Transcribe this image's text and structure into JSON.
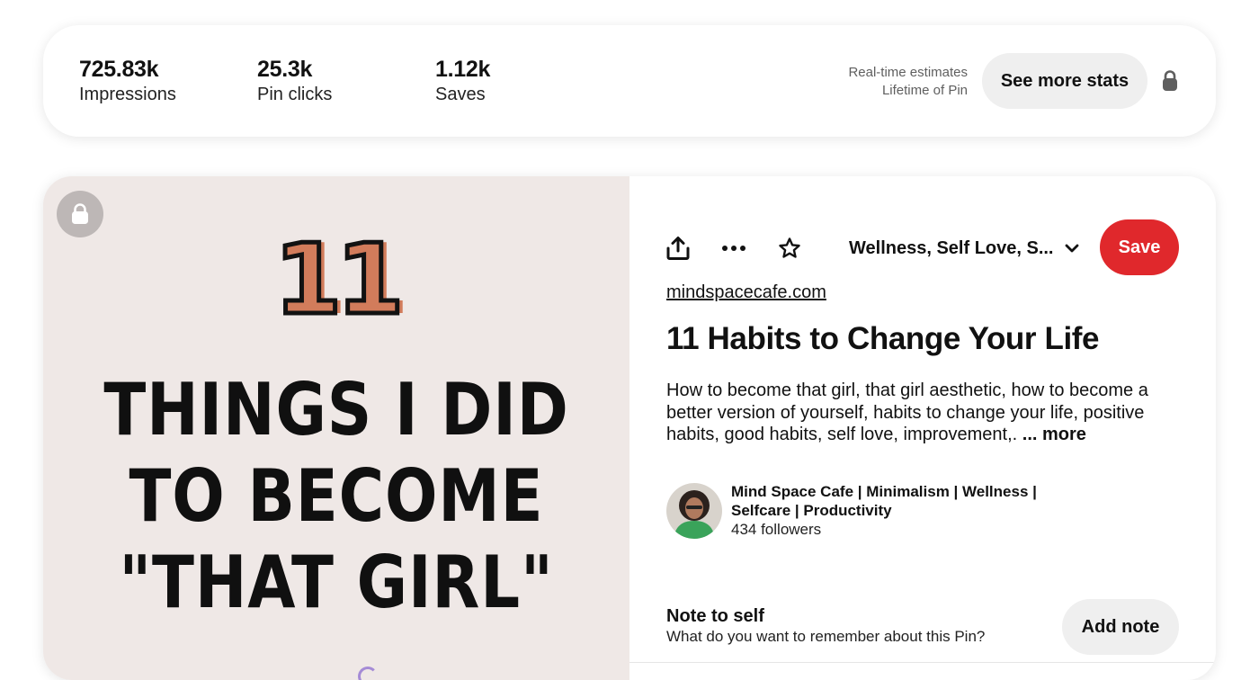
{
  "stats": {
    "impressions": {
      "value": "725.83k",
      "label": "Impressions"
    },
    "pin_clicks": {
      "value": "25.3k",
      "label": "Pin clicks"
    },
    "saves": {
      "value": "1.12k",
      "label": "Saves"
    },
    "estimate_line1": "Real-time estimates",
    "estimate_line2": "Lifetime of Pin",
    "see_more_label": "See more stats",
    "lock_icon": "lock-icon"
  },
  "pin_image": {
    "number": "11",
    "headline_lines": [
      "THINGS I DID",
      "TO BECOME",
      "\"THAT GIRL\""
    ],
    "background": "#efe8e6",
    "accent": "#d27c5b",
    "lock_icon": "lock-icon"
  },
  "toolbar": {
    "share_icon": "share-icon",
    "more_icon": "more-options-icon",
    "star_icon": "star-icon",
    "board_name": "Wellness, Self Love, S...",
    "chevron_icon": "chevron-down-icon",
    "save_label": "Save",
    "save_color": "#e0282c"
  },
  "pin": {
    "domain": "mindspacecafe.com",
    "title": "11 Habits to Change Your Life",
    "description": "How to become that girl, that girl aesthetic, how to become a better version of yourself, habits to change your life, positive habits, good habits, self love, improvement,.",
    "more_label": "... more"
  },
  "creator": {
    "name": "Mind Space Cafe | Minimalism | Wellness | Selfcare | Productivity",
    "followers": "434 followers"
  },
  "note": {
    "title": "Note to self",
    "prompt": "What do you want to remember about this Pin?",
    "add_label": "Add note"
  }
}
